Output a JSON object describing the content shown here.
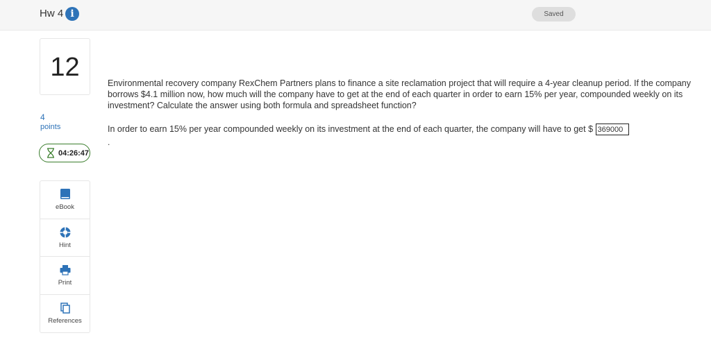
{
  "header": {
    "title": "Hw 4",
    "info_icon": "info-circle-icon",
    "saved_label": "Saved"
  },
  "sidebar": {
    "question_number": "12",
    "points_value": "4",
    "points_label": "points",
    "timer": "04:26:47",
    "tools": [
      {
        "label": "eBook",
        "icon": "book-icon"
      },
      {
        "label": "Hint",
        "icon": "lifebuoy-icon"
      },
      {
        "label": "Print",
        "icon": "printer-icon"
      },
      {
        "label": "References",
        "icon": "documents-icon"
      }
    ]
  },
  "question": {
    "text": "Environmental recovery company RexChem Partners plans to finance a site reclamation project that will require a 4-year cleanup period. If the company borrows $4.1 million now, how much will the company have to get at the end of each quarter in order to earn 15% per year, compounded weekly on its investment? Calculate the answer using both formula and spreadsheet function?",
    "answer_prompt": "In order to earn 15% per year compounded weekly on its investment at the end of each quarter, the company will have to get $",
    "answer_value": "369000",
    "trailing": "."
  },
  "colors": {
    "accent": "#2e73b8",
    "timer_border": "#3a7d2c",
    "header_bg": "#f6f6f6"
  }
}
